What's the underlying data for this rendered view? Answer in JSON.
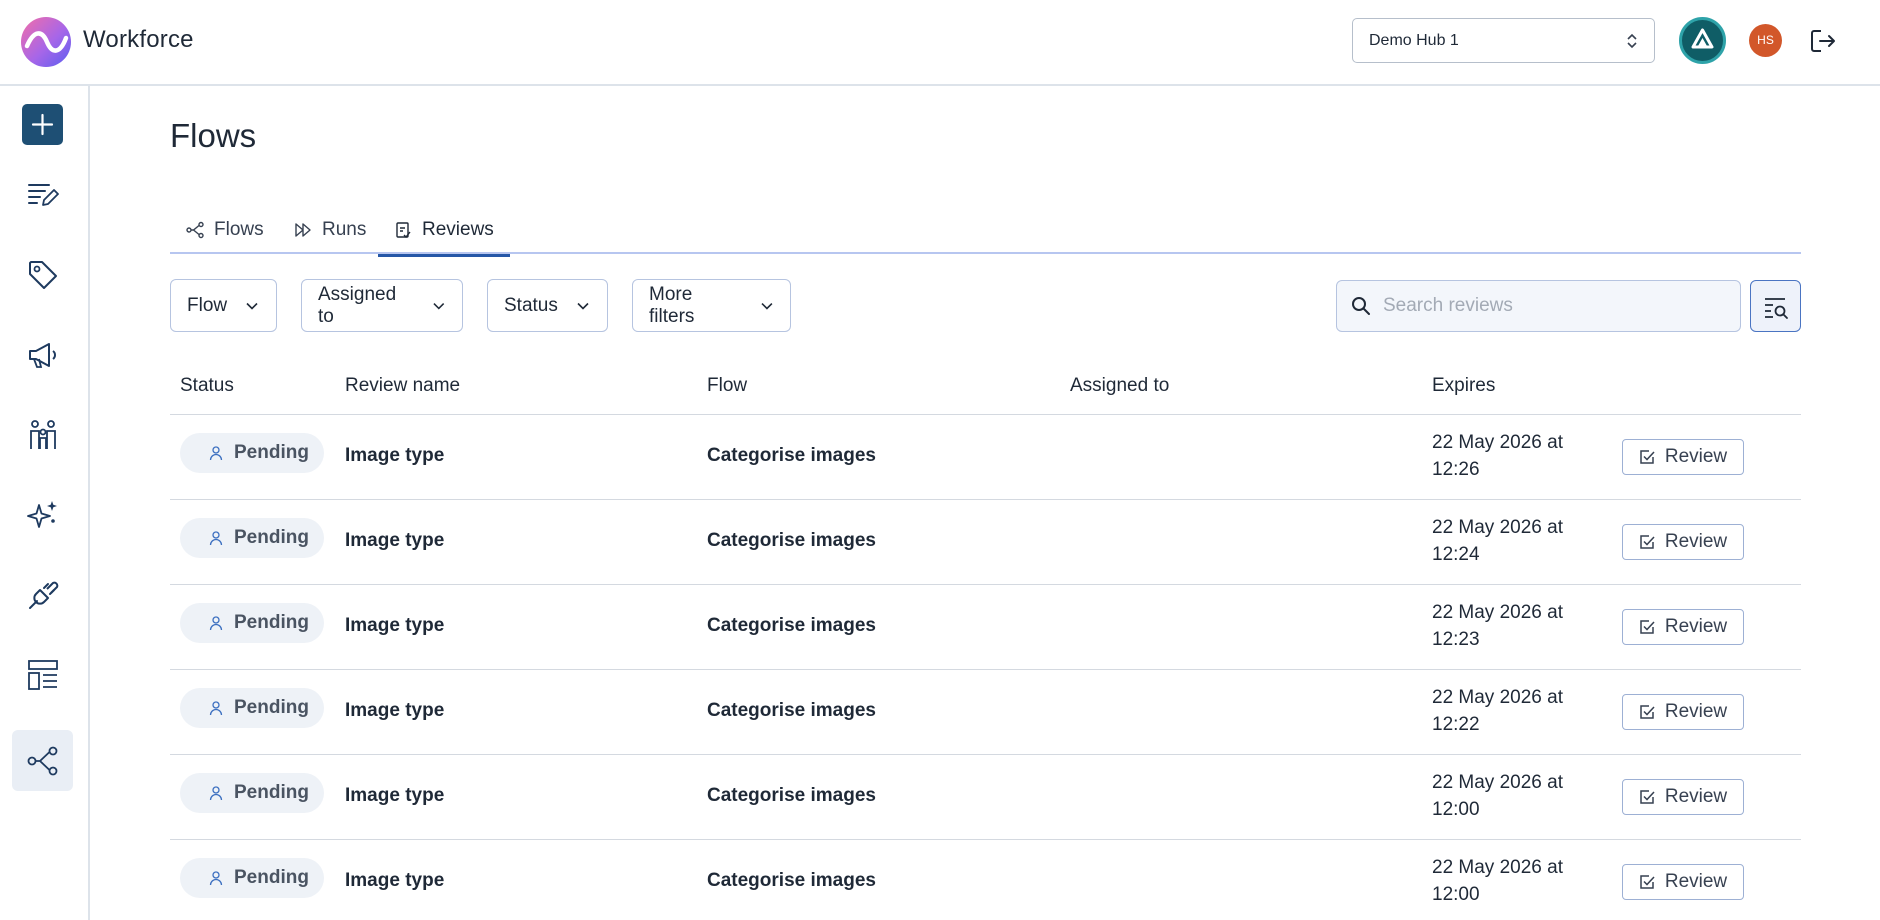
{
  "app": {
    "name": "Workforce"
  },
  "header": {
    "hub_select_value": "Demo Hub 1",
    "user_initials": "HS"
  },
  "page": {
    "title": "Flows"
  },
  "tabs": [
    {
      "label": "Flows",
      "icon": "share-nodes-icon",
      "active": false
    },
    {
      "label": "Runs",
      "icon": "fast-forward-icon",
      "active": false
    },
    {
      "label": "Reviews",
      "icon": "clipboard-check-icon",
      "active": true
    }
  ],
  "filters": [
    {
      "label": "Flow"
    },
    {
      "label": "Assigned to"
    },
    {
      "label": "Status"
    },
    {
      "label": "More filters"
    }
  ],
  "search": {
    "placeholder": "Search reviews",
    "value": ""
  },
  "table": {
    "columns": [
      "Status",
      "Review name",
      "Flow",
      "Assigned to",
      "Expires"
    ],
    "rows": [
      {
        "status": "Pending",
        "review_name": "Image type",
        "flow": "Categorise images",
        "assigned_to": "",
        "expires_line1": "22 May 2026 at",
        "expires_line2": "12:26",
        "action": "Review"
      },
      {
        "status": "Pending",
        "review_name": "Image type",
        "flow": "Categorise images",
        "assigned_to": "",
        "expires_line1": "22 May 2026 at",
        "expires_line2": "12:24",
        "action": "Review"
      },
      {
        "status": "Pending",
        "review_name": "Image type",
        "flow": "Categorise images",
        "assigned_to": "",
        "expires_line1": "22 May 2026 at",
        "expires_line2": "12:23",
        "action": "Review"
      },
      {
        "status": "Pending",
        "review_name": "Image type",
        "flow": "Categorise images",
        "assigned_to": "",
        "expires_line1": "22 May 2026 at",
        "expires_line2": "12:22",
        "action": "Review"
      },
      {
        "status": "Pending",
        "review_name": "Image type",
        "flow": "Categorise images",
        "assigned_to": "",
        "expires_line1": "22 May 2026 at",
        "expires_line2": "12:00",
        "action": "Review"
      },
      {
        "status": "Pending",
        "review_name": "Image type",
        "flow": "Categorise images",
        "assigned_to": "",
        "expires_line1": "22 May 2026 at",
        "expires_line2": "12:00",
        "action": "Review"
      }
    ]
  },
  "sidebar": {
    "items": [
      {
        "icon": "plus-icon",
        "active": false
      },
      {
        "icon": "edit-list-icon",
        "active": false
      },
      {
        "icon": "tag-icon",
        "active": false
      },
      {
        "icon": "megaphone-icon",
        "active": false
      },
      {
        "icon": "people-icon",
        "active": false
      },
      {
        "icon": "sparkle-icon",
        "active": false
      },
      {
        "icon": "plug-icon",
        "active": false
      },
      {
        "icon": "layout-icon",
        "active": false
      },
      {
        "icon": "share-nodes-icon",
        "active": true
      }
    ]
  },
  "colors": {
    "brand_dark": "#1e4f74",
    "accent_blue": "#2557a7",
    "org_avatar": "#0f5d66",
    "user_avatar": "#d2572a"
  }
}
